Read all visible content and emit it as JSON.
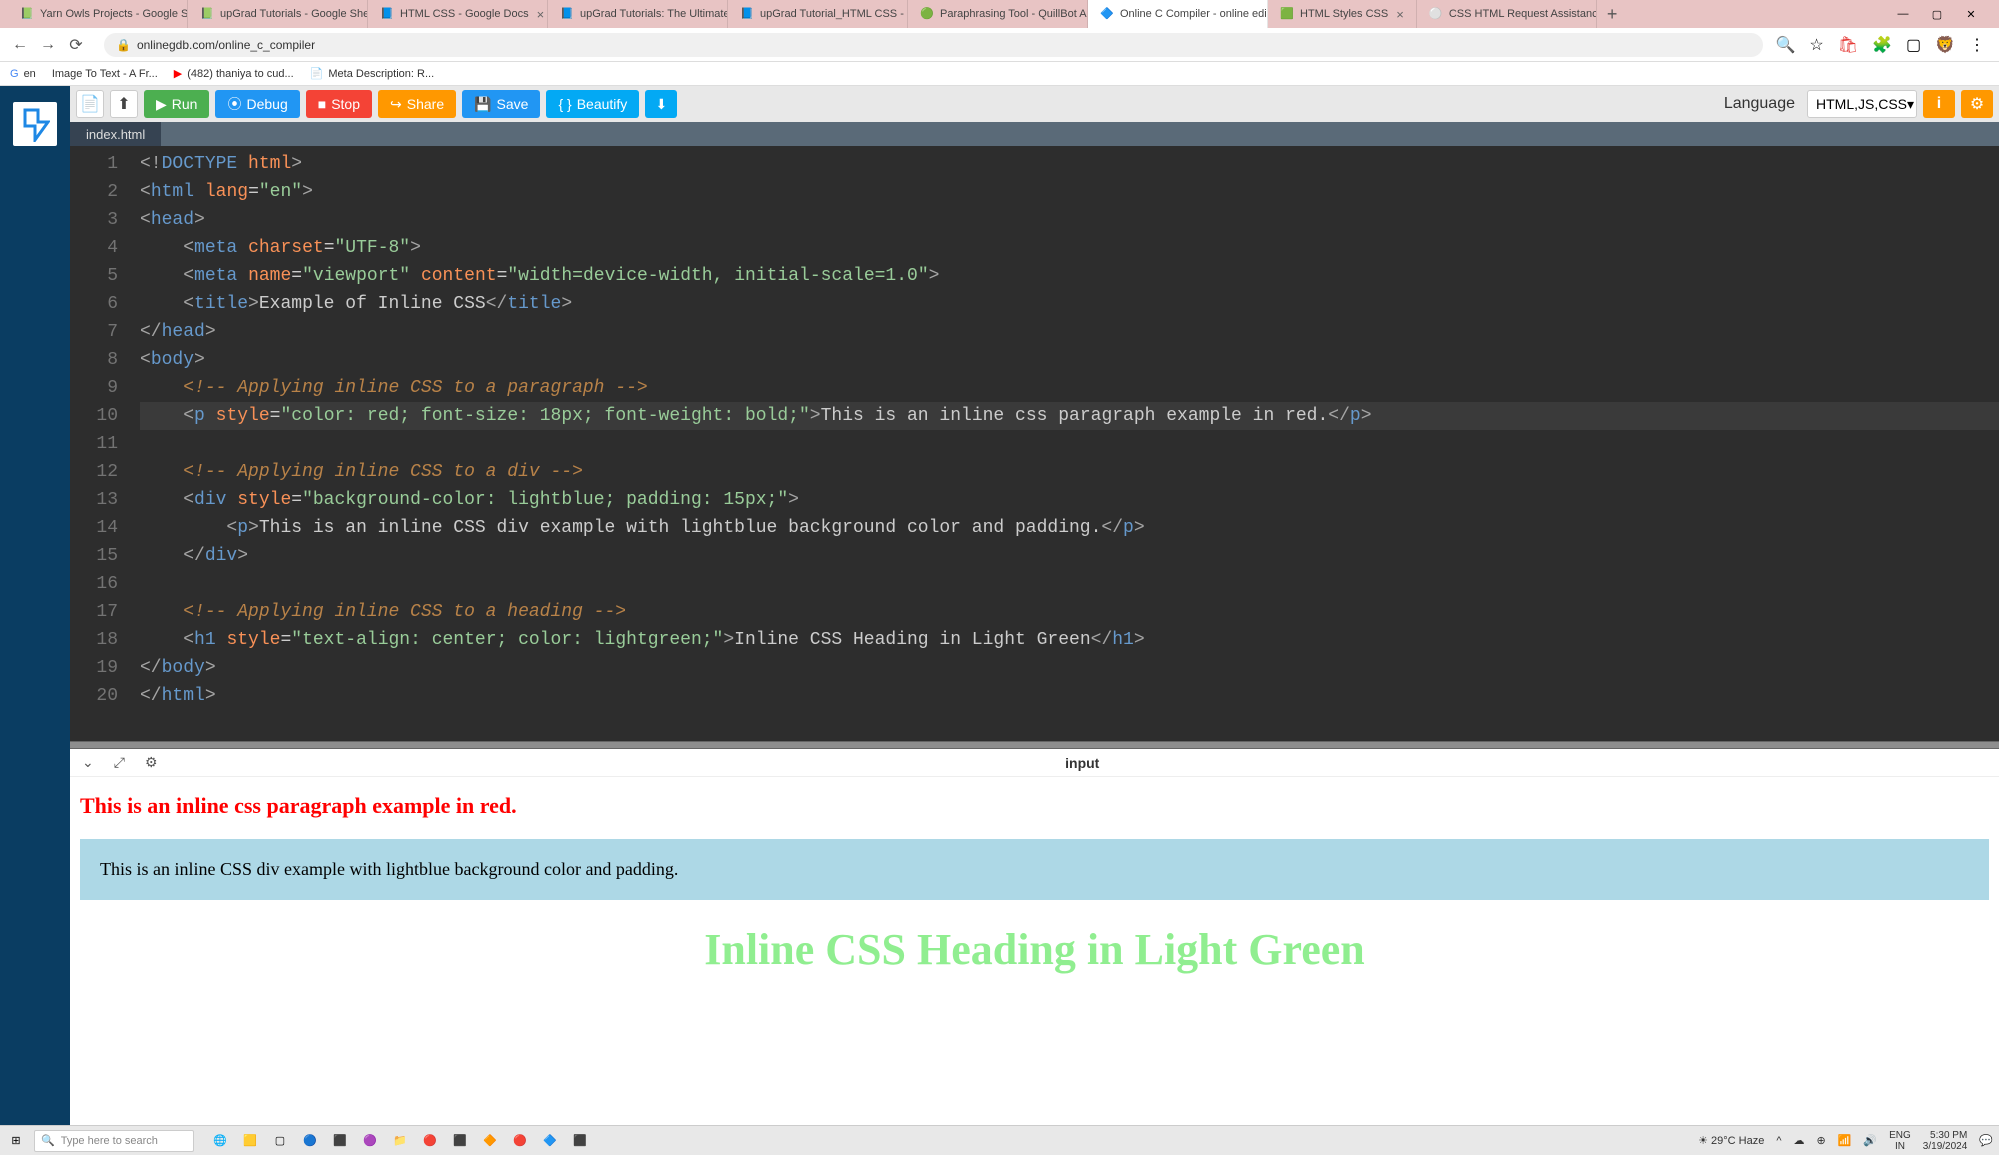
{
  "browser": {
    "tabs": [
      {
        "title": "Yarn Owls Projects - Google Sh"
      },
      {
        "title": "upGrad Tutorials - Google She"
      },
      {
        "title": "HTML CSS - Google Docs"
      },
      {
        "title": "upGrad Tutorials: The Ultimate"
      },
      {
        "title": "upGrad Tutorial_HTML CSS - G"
      },
      {
        "title": "Paraphrasing Tool - QuillBot AI"
      },
      {
        "title": "Online C Compiler - online edi"
      },
      {
        "title": "HTML Styles CSS"
      },
      {
        "title": "CSS HTML Request Assistance"
      }
    ],
    "url": "onlinegdb.com/online_c_compiler",
    "bookmarks": [
      "en",
      "Image To Text - A Fr...",
      "(482) thaniya to cud...",
      "Meta Description: R..."
    ]
  },
  "toolbar": {
    "run": "Run",
    "debug": "Debug",
    "stop": "Stop",
    "share": "Share",
    "save": "Save",
    "beautify": "Beautify",
    "language_label": "Language",
    "language_value": "HTML,JS,CSS"
  },
  "file_tab": "index.html",
  "code_lines": [
    "1",
    "2",
    "3",
    "4",
    "5",
    "6",
    "7",
    "8",
    "9",
    "10",
    "11",
    "12",
    "13",
    "14",
    "15",
    "16",
    "17",
    "18",
    "19",
    "20"
  ],
  "code": {
    "l1_doctype": "<!DOCTYPE html>",
    "l9_comment": "<!-- Applying inline CSS to a paragraph -->",
    "l10_text": "This is an inline css paragraph example in red.",
    "l12_comment": "<!-- Applying inline CSS to a div -->",
    "l14_text": "This is an inline CSS div example with lightblue background color and padding.",
    "l17_comment": "<!-- Applying inline CSS to a heading -->",
    "l18_text": "Inline CSS Heading in Light Green"
  },
  "output_panel": {
    "title": "input",
    "red_text": "This is an inline css paragraph example in red.",
    "blue_text": "This is an inline CSS div example with lightblue background color and padding.",
    "green_text": "Inline CSS Heading in Light Green"
  },
  "taskbar": {
    "search_placeholder": "Type here to search",
    "weather": "29°C Haze",
    "lang": "ENG",
    "region": "IN",
    "time": "5:30 PM",
    "date": "3/19/2024"
  }
}
